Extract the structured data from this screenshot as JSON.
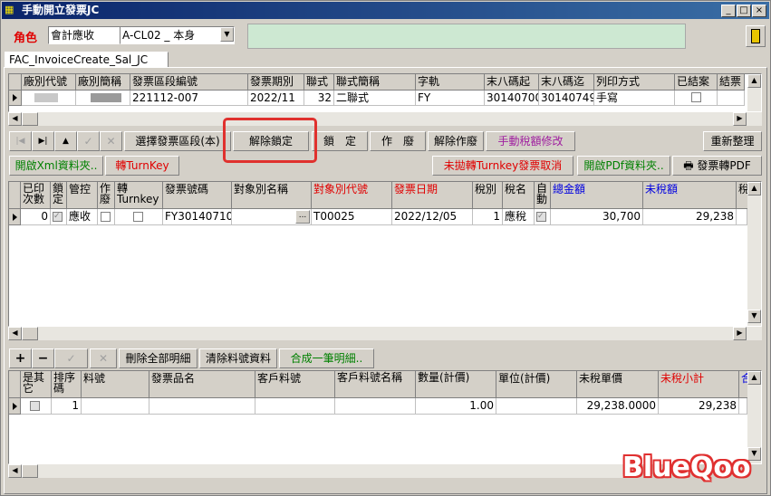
{
  "window": {
    "title": "手動開立發票JC",
    "minimize_glyph": "_",
    "maximize_glyph": "□",
    "close_glyph": "×"
  },
  "role": {
    "label": "角色",
    "value": "會計應收",
    "code_value": "A-CL02 _ 本身"
  },
  "tab": {
    "label": "FAC_InvoiceCreate_Sal_JC"
  },
  "top_grid": {
    "columns": [
      "廠別代號",
      "廠別簡稱",
      "發票區段編號",
      "發票期別",
      "聯式",
      "聯式簡稱",
      "字軌",
      "末八碼起",
      "末八碼迄",
      "列印方式",
      "已結案",
      "結票"
    ],
    "row": {
      "plant_code": "",
      "plant_name": "",
      "segment_no": "221112-007",
      "period": "2022/11",
      "copy_type": "32",
      "copy_name": "二聯式",
      "track": "FY",
      "start8": "30140700",
      "end8": "30140749",
      "print_method": "手寫",
      "closed": false,
      "close_ticket": ""
    }
  },
  "toolbar1": {
    "select_segment": "選擇發票區段(本)",
    "unlock": "解除鎖定",
    "lock": "鎖　定",
    "void": "作　廢",
    "unvoid": "解除作廢",
    "manual_tax": "手動稅額修改",
    "reorganize": "重新整理"
  },
  "toolbar2": {
    "open_xml": "開啟Xml資料夾..",
    "to_turnkey": "轉TurnKey",
    "cancel_turnkey": "未拋轉Turnkey發票取消",
    "open_pdf": "開啟PDf資料夾..",
    "to_pdf": "發票轉PDF"
  },
  "invoice_grid": {
    "columns": [
      "已印次數",
      "鎖定",
      "管控",
      "作廢",
      "轉Turnkey",
      "發票號碼",
      "對象別名稱",
      "對象別代號",
      "發票日期",
      "稅別",
      "稅名",
      "自動",
      "總金額",
      "未稅額",
      "稅"
    ],
    "row": {
      "printed_count": "0",
      "locked": true,
      "control": "應收",
      "voided": false,
      "turnkey": false,
      "invoice_no": "FY30140710",
      "target_name": "",
      "target_code": "T00025",
      "invoice_date": "2022/12/05",
      "tax_type": "1",
      "tax_name": "應稅",
      "auto": true,
      "total": "30,700",
      "untaxed": "29,238",
      "ellipsis": "..."
    }
  },
  "toolbar3": {
    "delete_all_details": "刪除全部明細",
    "clear_item_data": "清除料號資料",
    "merge_one_detail": "合成一筆明細.."
  },
  "detail_grid": {
    "columns": [
      "是其它",
      "排序碼",
      "料號",
      "發票品名",
      "客戶料號",
      "客戶料號名稱",
      "數量(計價)",
      "單位(計價)",
      "未稅單價",
      "未稅小計",
      "合"
    ],
    "row": {
      "is_other": false,
      "sort_code": "1",
      "item_no": "",
      "invoice_item_name": "",
      "customer_item_no": "",
      "customer_item_name": "",
      "quantity": "1.00",
      "unit": "",
      "unit_price": "29,238.0000",
      "subtotal": "29,238"
    }
  },
  "watermark": "BlueQoo",
  "colors": {
    "title_start": "#0a246a",
    "title_end": "#3a6ea5",
    "highlight": "#e0312e",
    "green_panel": "#cde8d2"
  }
}
